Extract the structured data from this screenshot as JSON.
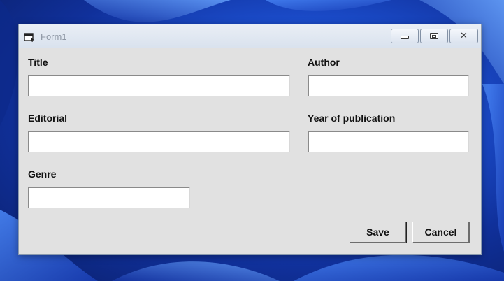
{
  "window": {
    "title": "Form1",
    "icon": "form-window-icon"
  },
  "titlebar_buttons": {
    "minimize_icon": "minimize-icon",
    "maximize_icon": "maximize-icon",
    "close_icon": "close-icon",
    "close_glyph": "✕"
  },
  "form": {
    "title_label": "Title",
    "author_label": "Author",
    "editorial_label": "Editorial",
    "year_label": "Year of publication",
    "genre_label": "Genre",
    "title_value": "",
    "author_value": "",
    "editorial_value": "",
    "year_value": "",
    "genre_value": ""
  },
  "buttons": {
    "save": "Save",
    "cancel": "Cancel"
  },
  "colors": {
    "window_bg": "#e1e1e1",
    "desktop_accent": "#1c4fd0"
  }
}
